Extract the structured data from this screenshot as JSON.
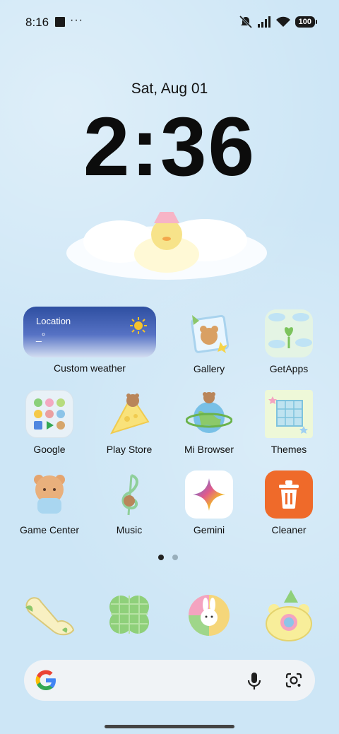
{
  "status_bar": {
    "time": "8:16",
    "overflow": "···",
    "battery": "100",
    "icons": [
      "mute-icon",
      "signal-icon",
      "wifi-icon",
      "battery-icon"
    ]
  },
  "lock": {
    "date": "Sat, Aug 01",
    "time": "2:36"
  },
  "weather_widget": {
    "location": "Location",
    "temperature": "_°",
    "label": "Custom weather"
  },
  "apps": [
    {
      "label": "Gallery"
    },
    {
      "label": "GetApps"
    },
    {
      "label": "Google"
    },
    {
      "label": "Play Store"
    },
    {
      "label": "Mi Browser"
    },
    {
      "label": "Themes"
    },
    {
      "label": "Game Center"
    },
    {
      "label": "Music"
    },
    {
      "label": "Gemini"
    },
    {
      "label": "Cleaner"
    }
  ],
  "pager": {
    "pages": 2,
    "current": 1
  },
  "dock": [
    "phone-icon",
    "clover-icon",
    "bunny-icon",
    "camera-icon"
  ],
  "search_bar": {
    "icons": [
      "google-g-icon",
      "mic-icon",
      "lens-icon"
    ]
  },
  "colors": {
    "wallpaper": "#cde6f6",
    "cleaner": "#ef6a2a",
    "gemini_bg": "#ffffff"
  }
}
